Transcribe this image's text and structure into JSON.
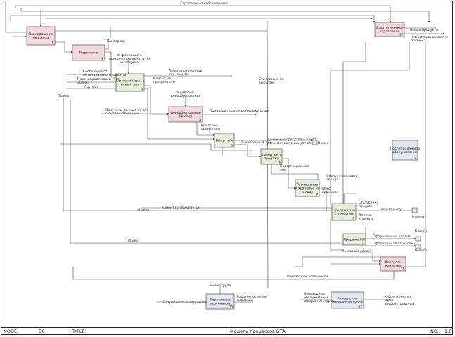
{
  "title": "Модель процессов БТА",
  "footer": {
    "node_label": "NODE:",
    "node_value": "B0",
    "title_label": "TITLE:",
    "no_label": "NO.:",
    "no_value": "1.0"
  },
  "colors": {
    "red_box": "#f1d9dc",
    "green_box": "#e6eedc",
    "blue_box": "#e1e6f1",
    "line": "#444444"
  },
  "boxes": [
    {
      "id": "b1",
      "num": "1",
      "text": [
        "Планирование",
        "бюджета"
      ],
      "color": "red"
    },
    {
      "id": "b2",
      "num": "2",
      "text": [
        "Маркетинг"
      ],
      "color": "red"
    },
    {
      "id": "b3",
      "num": "3",
      "text": [
        "Коммуникации с",
        "клиентами"
      ],
      "color": "green"
    },
    {
      "id": "b4",
      "num": "4",
      "text": [
        "Ценообразование",
        "(Pricing)"
      ],
      "color": "red"
    },
    {
      "id": "b5",
      "num": "5",
      "text": [
        "Выкуп а/м"
      ],
      "color": "green"
    },
    {
      "id": "b6",
      "num": "6",
      "text": [
        "Вывод а/м в",
        "продажу"
      ],
      "color": "green"
    },
    {
      "id": "b7",
      "num": "7",
      "text": [
        "Размещение",
        "и хранение на",
        "складе"
      ],
      "color": "green"
    },
    {
      "id": "b8",
      "num": "8",
      "text": [
        "Продажа а/м",
        "с пробегом"
      ],
      "color": "green"
    },
    {
      "id": "b9",
      "num": "9",
      "text": [
        "Продажа F&I"
      ],
      "color": "green"
    },
    {
      "id": "b10",
      "num": "10",
      "text": [
        "Стратегическое",
        "управление"
      ],
      "color": "red"
    },
    {
      "id": "b11",
      "num": "11",
      "text": [
        "Контроль",
        "качества"
      ],
      "color": "red"
    },
    {
      "id": "b12",
      "num": "12",
      "text": [
        "Управление",
        "инфраструктурой"
      ],
      "color": "blue"
    },
    {
      "id": "b13",
      "num": "13",
      "text": [
        "Управление",
        "персоналом"
      ],
      "color": "blue"
    },
    {
      "id": "b14",
      "num": "14",
      "text": [
        "Послепродажное",
        "обслуживание"
      ],
      "color": "blue"
    }
  ],
  "labels": {
    "strategy_owner": "Стратегия от собственника",
    "new_products": "Новые продукты",
    "business_concept": [
      "Концепция развития",
      "бизнеса"
    ],
    "conversion": "Конверсия",
    "info_priority": [
      "Информация о",
      "приоритетах выкупа по",
      "категориям"
    ],
    "lead_messages": [
      "Сообщения от",
      "потенциального клиента"
    ],
    "redirected_test_drive": [
      "Перенаправленный тест",
      "драйва"
    ],
    "passport": "Паспорт",
    "redirected_req": [
      "Перенаправленный",
      "тех. звонок"
    ],
    "client_sale_buy": [
      "Клиент на",
      "продажу а/м"
    ],
    "pricing_criteria": [
      "Критерии",
      "ценообразования"
    ],
    "buyout_stats": [
      "Статистика по",
      "выкупам"
    ],
    "plans_left": "Планы",
    "received_data": [
      "Получены данные по а/м",
      "с онлайн-площадок"
    ],
    "prelim_price": "Предварительная цена выкупа а/м",
    "eval_criteria": [
      "Критерии",
      "оценки а/м"
    ],
    "cash_docs": [
      "Денежные средства и пакет",
      "документов по выкупу а/м"
    ],
    "new_label": "Новые",
    "bought_car": "Выкупленный а/м",
    "prepared_car": [
      "Подготовленный",
      "а/м"
    ],
    "serviced_car": [
      "Обслуживаемость",
      "склада"
    ],
    "stock_car": [
      "а/м с",
      "хранения"
    ],
    "sale_stats": [
      "Статистика",
      "продаж"
    ],
    "client_data": [
      "Данные",
      "клиента"
    ],
    "car_to_client": "а/м клиенту",
    "client_label": "Клиент",
    "plans_mid": "Планы",
    "client_buy": "Клиент на покупку а/м",
    "plans_low": "Планы",
    "credit_done": "Оформленный кредит",
    "insurance_done": "Оформленная страховка",
    "client_top": "Клиент",
    "client_bottom": "Клиент",
    "loyal_client": "Лояльный клиент",
    "loyalty_index": "Показатели лояльности",
    "labor_market": "Рынок труда",
    "staff_need": "Потребность в персонале",
    "working_staff": [
      "Работоспособный",
      "персонал"
    ],
    "infra_need": [
      "Необходимо",
      "обслуживание",
      "инфраструктуры"
    ],
    "infra_served": [
      "Обслуженная в",
      "срок",
      "инфраструктура"
    ]
  }
}
